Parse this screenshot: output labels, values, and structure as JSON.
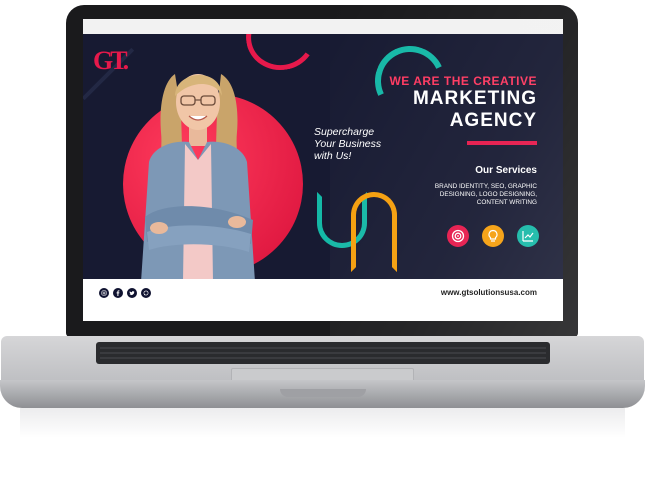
{
  "logo": {
    "text": "GT."
  },
  "banner": {
    "kicker": "WE ARE THE CREATIVE",
    "headline_line1": "MARKETING",
    "headline_line2": "AGENCY",
    "tagline_line1": "Supercharge",
    "tagline_line2": "Your Business",
    "tagline_line3": "with Us!",
    "services_title": "Our Services",
    "services_line1": "BRAND IDENTITY, SEO, GRAPHIC",
    "services_line2": "DESIGNING, LOGO DESIGNING,",
    "services_line3": "CONTENT WRITING",
    "service_icons": [
      {
        "name": "target-icon",
        "color": "#e6194b"
      },
      {
        "name": "lightbulb-icon",
        "color": "#f59e0b"
      },
      {
        "name": "growth-chart-icon",
        "color": "#14b8a6"
      }
    ]
  },
  "footer": {
    "social_icons": [
      "instagram-icon",
      "facebook-icon",
      "twitter-icon",
      "whatsapp-icon"
    ],
    "website": "www.gtsolutionsusa.com"
  },
  "colors": {
    "banner_bg": "#171a32",
    "accent_red": "#e6194b",
    "accent_teal": "#14b8a6",
    "accent_orange": "#f59e0b"
  }
}
